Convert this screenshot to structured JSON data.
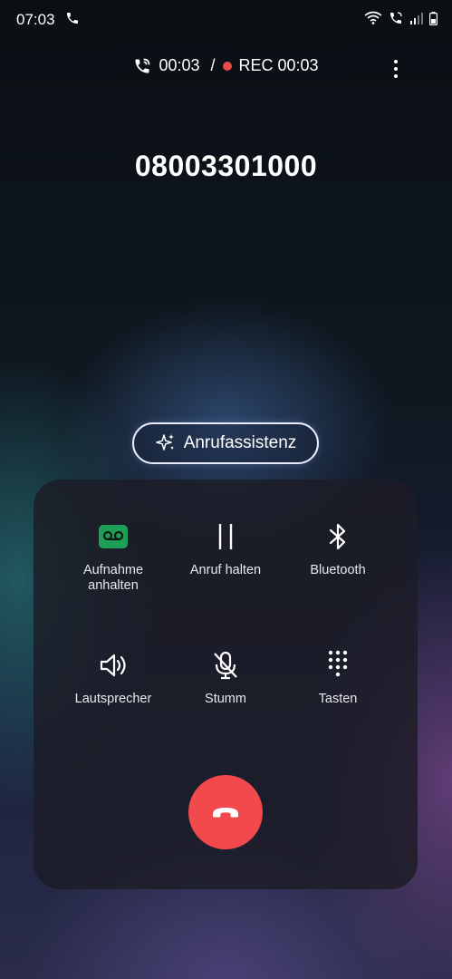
{
  "status_bar": {
    "time": "07:03"
  },
  "call_info": {
    "duration": "00:03",
    "separator": "/",
    "rec_label": "REC 00:03"
  },
  "caller": {
    "number": "08003301000"
  },
  "assistant": {
    "label": "Anrufassistenz"
  },
  "controls": [
    {
      "label_line1": "Aufnahme",
      "label_line2": "anhalten",
      "icon": "voicemail-icon",
      "active_color": "#1e9e57"
    },
    {
      "label_line1": "Anruf halten",
      "label_line2": "",
      "icon": "pause-icon"
    },
    {
      "label_line1": "Bluetooth",
      "label_line2": "",
      "icon": "bluetooth-icon"
    },
    {
      "label_line1": "Lautsprecher",
      "label_line2": "",
      "icon": "speaker-icon"
    },
    {
      "label_line1": "Stumm",
      "label_line2": "",
      "icon": "mic-off-icon"
    },
    {
      "label_line1": "Tasten",
      "label_line2": "",
      "icon": "keypad-icon"
    }
  ],
  "end_call": {
    "icon": "end-call-icon",
    "color": "#f24a4c"
  }
}
